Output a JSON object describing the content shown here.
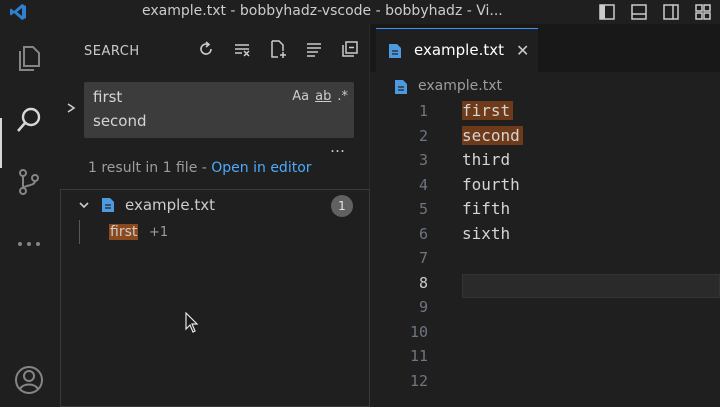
{
  "window": {
    "title": "example.txt - bobbyhadz-vscode - bobbyhadz - Vi..."
  },
  "activity_bar": {
    "items": [
      {
        "name": "explorer",
        "icon": "files-icon"
      },
      {
        "name": "search",
        "icon": "search-icon",
        "active": true
      },
      {
        "name": "source-control",
        "icon": "source-control-icon"
      },
      {
        "name": "more",
        "icon": "ellipsis-icon"
      },
      {
        "name": "accounts",
        "icon": "account-icon"
      }
    ]
  },
  "sidebar": {
    "title": "SEARCH",
    "actions": [
      "refresh-icon",
      "clear-results-icon",
      "new-search-editor-icon",
      "view-as-tree-icon",
      "collapse-all-icon"
    ],
    "search": {
      "lines": [
        "first",
        "second"
      ],
      "options": {
        "match_case": "Aa",
        "whole_word": "ab",
        "regex": ".*"
      }
    },
    "more": "…",
    "results": {
      "message": "1 result in 1 file - ",
      "open_link": "Open in editor",
      "file": {
        "name": "example.txt",
        "count": "1"
      },
      "match": {
        "text": "first",
        "extra": "+1"
      }
    }
  },
  "editor": {
    "tab": {
      "label": "example.txt",
      "close": "✕"
    },
    "breadcrumb": "example.txt",
    "line_numbers": [
      "1",
      "2",
      "3",
      "4",
      "5",
      "6",
      "7",
      "8",
      "9",
      "10",
      "11",
      "12"
    ],
    "active_line": "8",
    "lines": [
      "first",
      "second",
      "third",
      "fourth",
      "fifth",
      "sixth",
      "",
      "",
      "",
      "",
      "",
      ""
    ],
    "highlighted_lines": [
      0,
      1
    ]
  },
  "colors": {
    "accent": "#3794ff",
    "match_highlight": "#6e3a1a",
    "link": "#4daafc",
    "file_icon": "#4d9bde"
  }
}
